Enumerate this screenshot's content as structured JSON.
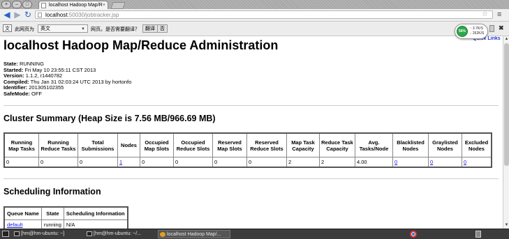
{
  "browser": {
    "tab_title": "localhost Hadoop Map/R",
    "url_host": "localhost",
    "url_path": ":50030/jobtracker.jsp"
  },
  "translate_bar": {
    "icon_text": "文",
    "prefix": "此网页为",
    "language": "英文",
    "prompt": "网页。是否需要翻译？",
    "translate_button": "翻译",
    "no_button": "否"
  },
  "speed_widget": {
    "percent": "56%",
    "up": "3.7K/S",
    "down": "262K/S"
  },
  "page": {
    "quick_links": "Quick Links",
    "title": "localhost Hadoop Map/Reduce Administration",
    "info": [
      {
        "label": "State:",
        "value": "RUNNING"
      },
      {
        "label": "Started:",
        "value": "Fri May 10 23:55:11 CST 2013"
      },
      {
        "label": "Version:",
        "value": "1.1.2, r1440782"
      },
      {
        "label": "Compiled:",
        "value": "Thu Jan 31 02:03:24 UTC 2013 by hortonfo"
      },
      {
        "label": "Identifier:",
        "value": "201305102355"
      },
      {
        "label": "SafeMode:",
        "value": "OFF"
      }
    ],
    "cluster_summary_heading": "Cluster Summary (Heap Size is 7.56 MB/966.69 MB)",
    "cluster_summary": {
      "headers": [
        "Running Map Tasks",
        "Running Reduce Tasks",
        "Total Submissions",
        "Nodes",
        "Occupied Map Slots",
        "Occupied Reduce Slots",
        "Reserved Map Slots",
        "Reserved Reduce Slots",
        "Map Task Capacity",
        "Reduce Task Capacity",
        "Avg. Tasks/Node",
        "Blacklisted Nodes",
        "Graylisted Nodes",
        "Excluded Nodes"
      ],
      "values": [
        "0",
        "0",
        "0",
        "1",
        "0",
        "0",
        "0",
        "0",
        "2",
        "2",
        "4.00",
        "0",
        "0",
        "0"
      ]
    },
    "scheduling_heading": "Scheduling Information",
    "scheduling": {
      "headers": [
        "Queue Name",
        "State",
        "Scheduling Information"
      ],
      "row": [
        "default",
        "running",
        "N/A"
      ]
    }
  },
  "taskbar": {
    "items": [
      "[hm@hm-ubuntu: ~]",
      "[hm@hm-ubuntu: ~/...",
      "localhost Hadoop Map/..."
    ]
  }
}
